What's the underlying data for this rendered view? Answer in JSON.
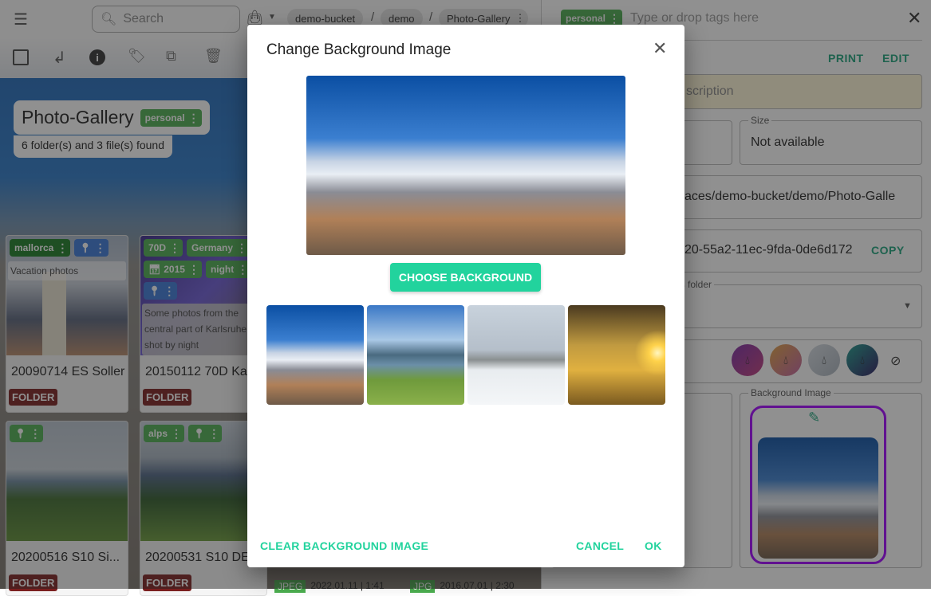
{
  "topbar": {
    "search_placeholder": "Search",
    "breadcrumbs": [
      "demo-bucket",
      "demo",
      "Photo-Gallery"
    ],
    "separator": "/"
  },
  "toolbar": {
    "icons": [
      "checkbox-icon",
      "return-icon",
      "info-icon",
      "tag-icon",
      "copy-icon",
      "delete-icon"
    ]
  },
  "gallery": {
    "title": "Photo-Gallery",
    "title_tag": "personal",
    "summary": "6 folder(s) and 3 file(s) found"
  },
  "cards": [
    {
      "name": "20090714 ES Soller",
      "tags": [
        "mallorca"
      ],
      "description": "Vacation photos",
      "type": "FOLDER"
    },
    {
      "name": "20150112 70D Ka",
      "tags": [
        "70D",
        "Germany",
        "2015",
        "night"
      ],
      "description": "Some photos from the central part of Karlsruhe shot by night",
      "type": "FOLDER"
    },
    {
      "name": "20200516 S10 Si...",
      "tags": [],
      "type": "FOLDER"
    },
    {
      "name": "20200531 S10 DE",
      "tags": [
        "alps"
      ],
      "type": "FOLDER"
    }
  ],
  "files": [
    {
      "type": "JPEG",
      "date": "2022.01.11 | 1:41"
    },
    {
      "type": "JPG",
      "date": "2016.07.01 | 2:30"
    }
  ],
  "right_panel": {
    "tag": "personal",
    "tags_placeholder": "Type or drop tags here",
    "print": "PRINT",
    "edit": "EDIT",
    "description_fragment": "scription",
    "size_label": "Size",
    "size_value": "Not available",
    "path_fragment": "aces/demo-bucket/demo/Photo-Galle",
    "id_fragment": "20-55a2-11ec-9fda-0de6d172",
    "copy": "COPY",
    "folder_label_fragment": "is folder",
    "background_image_label": "Background Image",
    "colors": [
      "#8e2c9a",
      "#d28a4c",
      "#9aa2ad",
      "#1b6d70"
    ],
    "highlight_color": "#a100ff"
  },
  "dialog": {
    "title": "Change Background Image",
    "choose": "CHOOSE BACKGROUND",
    "clear": "CLEAR BACKGROUND IMAGE",
    "cancel": "CANCEL",
    "ok": "OK",
    "accent": "#22d39d"
  }
}
